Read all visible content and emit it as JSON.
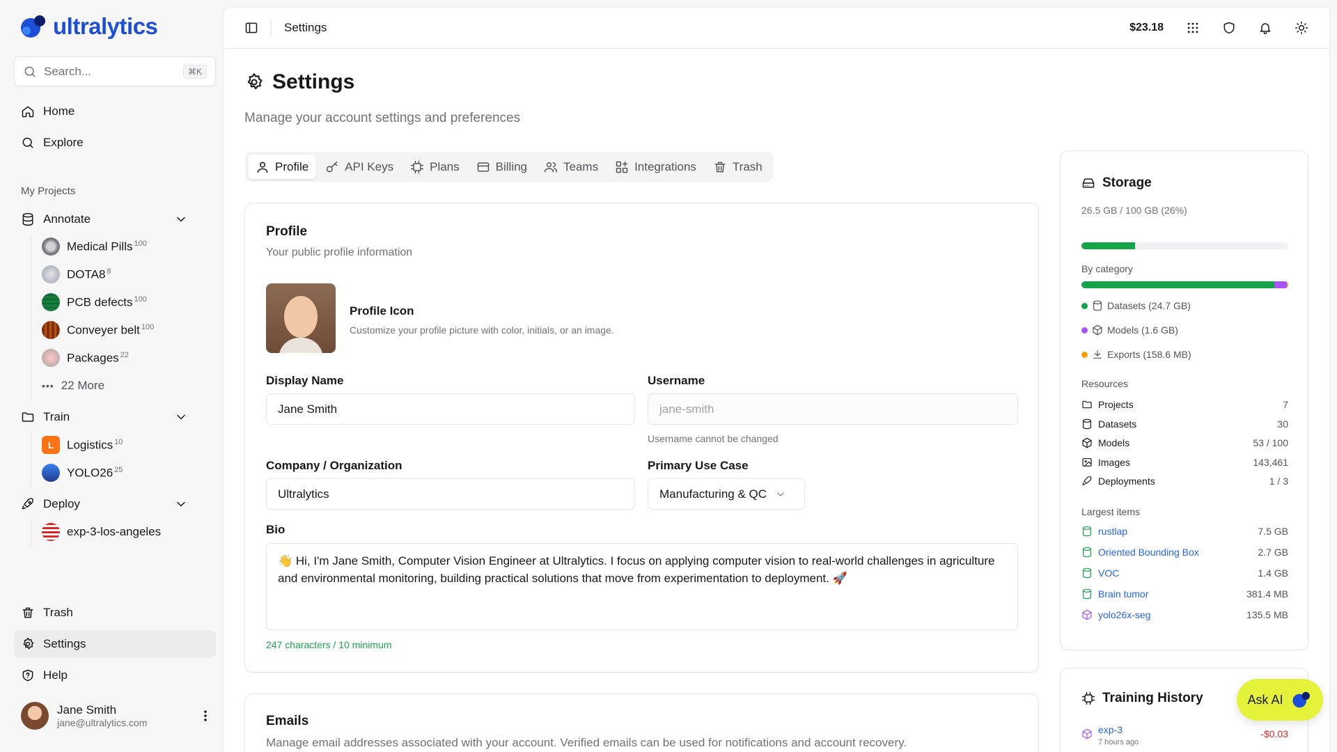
{
  "brand": {
    "name": "ultralytics"
  },
  "search": {
    "placeholder": "Search...",
    "shortcut": "⌘K"
  },
  "nav": {
    "home": "Home",
    "explore": "Explore",
    "trash": "Trash",
    "settings": "Settings",
    "help": "Help"
  },
  "projects": {
    "label": "My Projects",
    "annotate": {
      "label": "Annotate",
      "items": [
        {
          "name": "Medical Pills",
          "count": "100"
        },
        {
          "name": "DOTA8",
          "count": "8"
        },
        {
          "name": "PCB defects",
          "count": "100"
        },
        {
          "name": "Conveyer belt",
          "count": "100"
        },
        {
          "name": "Packages",
          "count": "22"
        }
      ],
      "more": "22 More"
    },
    "train": {
      "label": "Train",
      "items": [
        {
          "name": "Logistics",
          "count": "10",
          "initial": "L"
        },
        {
          "name": "YOLO26",
          "count": "25"
        }
      ]
    },
    "deploy": {
      "label": "Deploy",
      "items": [
        {
          "name": "exp-3-los-angeles"
        }
      ]
    }
  },
  "user": {
    "name": "Jane Smith",
    "email": "jane@ultralytics.com"
  },
  "topbar": {
    "breadcrumb": "Settings",
    "credit": "$23.18"
  },
  "page": {
    "title": "Settings",
    "subtitle": "Manage your account settings and preferences"
  },
  "tabs": [
    "Profile",
    "API Keys",
    "Plans",
    "Billing",
    "Teams",
    "Integrations",
    "Trash"
  ],
  "profile": {
    "title": "Profile",
    "subtitle": "Your public profile information",
    "icon_title": "Profile Icon",
    "icon_desc": "Customize your profile picture with color, initials, or an image.",
    "display_name_label": "Display Name",
    "display_name": "Jane Smith",
    "username_label": "Username",
    "username": "jane-smith",
    "username_hint": "Username cannot be changed",
    "company_label": "Company / Organization",
    "company": "Ultralytics",
    "use_case_label": "Primary Use Case",
    "use_case": "Manufacturing & QC",
    "bio_label": "Bio",
    "bio": "👋 Hi, I'm Jane Smith, Computer Vision Engineer at Ultralytics. I focus on applying computer vision to real-world challenges in agriculture and environmental monitoring, building practical solutions that move from experimentation to deployment. 🚀",
    "bio_count": "247 characters / 10 minimum"
  },
  "emails": {
    "title": "Emails",
    "subtitle": "Manage email addresses associated with your account. Verified emails can be used for notifications and account recovery."
  },
  "storage": {
    "title": "Storage",
    "usage": "26.5 GB / 100 GB (26%)",
    "usage_fraction": 0.26,
    "by_category_label": "By category",
    "categories": [
      {
        "label": "Datasets (24.7 GB)",
        "color": "#16a34a",
        "gb": 24.7
      },
      {
        "label": "Models (1.6 GB)",
        "color": "#a855f7",
        "gb": 1.6
      },
      {
        "label": "Exports (158.6 MB)",
        "color": "#f59e0b",
        "gb": 0.1586
      }
    ],
    "resources_label": "Resources",
    "resources": [
      {
        "label": "Projects",
        "value": "7"
      },
      {
        "label": "Datasets",
        "value": "30"
      },
      {
        "label": "Models",
        "value": "53 / 100"
      },
      {
        "label": "Images",
        "value": "143,461"
      },
      {
        "label": "Deployments",
        "value": "1 / 3"
      }
    ],
    "largest_label": "Largest items",
    "largest": [
      {
        "label": "rustlap",
        "value": "7.5 GB"
      },
      {
        "label": "Oriented Bounding Box",
        "value": "2.7 GB"
      },
      {
        "label": "VOC",
        "value": "1.4 GB"
      },
      {
        "label": "Brain tumor",
        "value": "381.4 MB"
      },
      {
        "label": "yolo26x-seg",
        "value": "135.5 MB"
      }
    ]
  },
  "training": {
    "title": "Training History",
    "items": [
      {
        "name": "exp-3",
        "time": "7 hours ago",
        "cost": "-$0.03"
      }
    ]
  },
  "ask_ai": "Ask AI",
  "colors": {
    "brand_blue": "#1d4ed8",
    "ask_ai_bg": "#e4f33a",
    "success": "#16a34a",
    "link": "#2563eb",
    "danger": "#dc2626"
  }
}
